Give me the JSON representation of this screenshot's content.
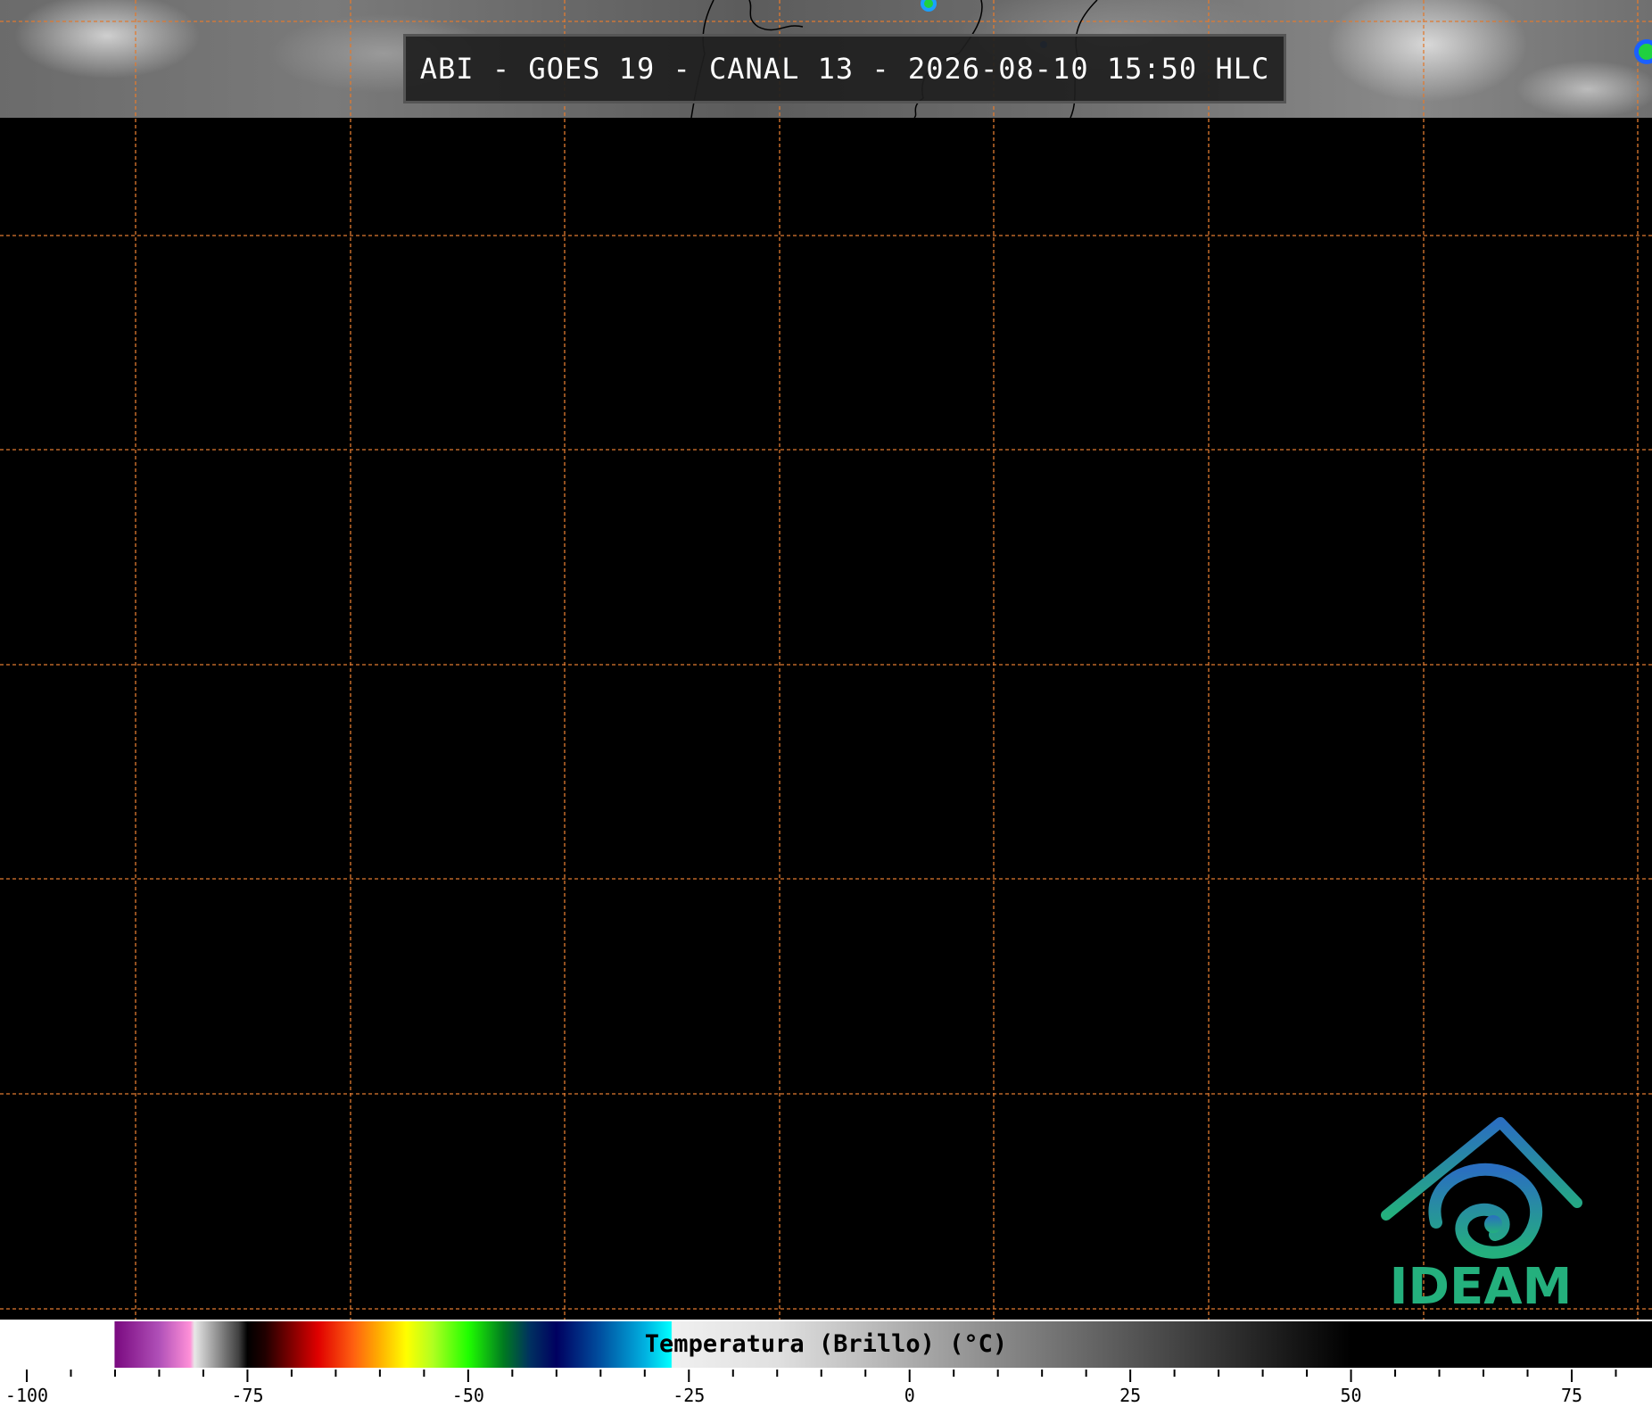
{
  "title": "ABI - GOES 19 - CANAL 13 - 2026-08-10 15:50 HLC",
  "logo": {
    "text": "IDEAM",
    "icon": "ideam-logo-icon"
  },
  "colorbar": {
    "label": "Temperatura (Brillo) (°C)",
    "tick_labels": [
      "-100",
      "-75",
      "-50",
      "-25",
      "0",
      "25",
      "50",
      "75"
    ],
    "tick_values": [
      -100,
      -75,
      -50,
      -25,
      0,
      25,
      50,
      75
    ],
    "range": [
      -103,
      84
    ]
  },
  "colors": {
    "grid": "#e07a30",
    "background": "#000000",
    "logo": "#24b07d"
  }
}
